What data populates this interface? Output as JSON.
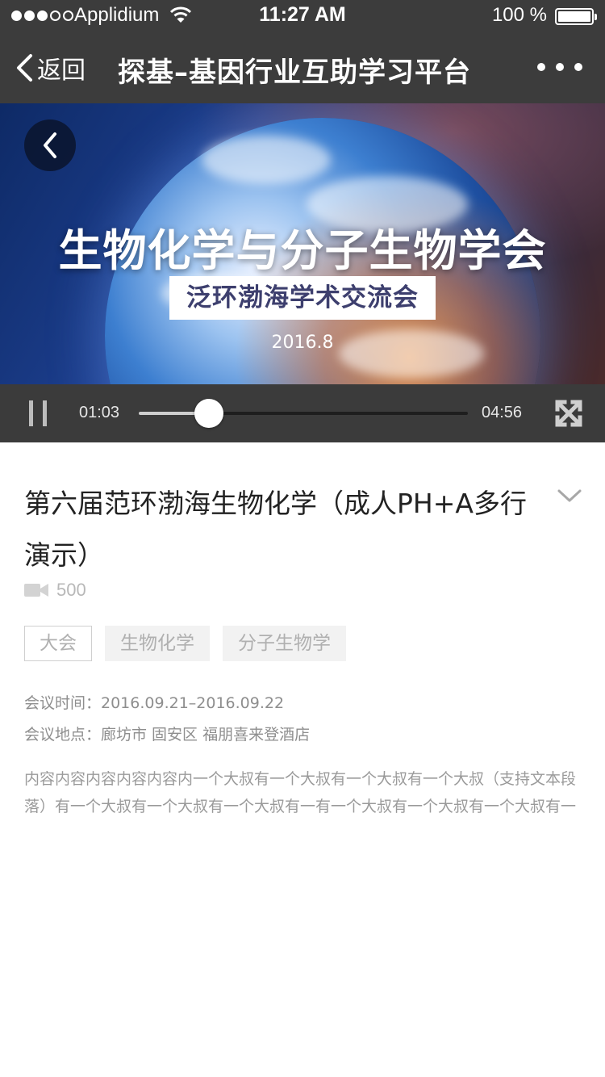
{
  "status_bar": {
    "carrier": "Applidium",
    "time": "11:27 AM",
    "battery": "100 %"
  },
  "nav": {
    "back_label": "返回",
    "title": "探基–基因行业互助学习平台"
  },
  "video": {
    "title": "生物化学与分子生物学会",
    "subtitle": "泛环渤海学术交流会",
    "date": "2016.8",
    "current_time": "01:03",
    "duration": "04:56",
    "progress": 0.213
  },
  "article": {
    "title": "第六届范环渤海生物化学（成人PH+A多行演示）",
    "views": "500",
    "tags": [
      "大会",
      "生物化学",
      "分子生物学"
    ],
    "meeting_time": "会议时间：2016.09.21–2016.09.22",
    "meeting_place": "会议地点：廊坊市 固安区 福朋喜来登酒店",
    "description": "内容内容内容内容内容内一个大叔有一个大叔有一个大叔有一个大叔（支持文本段落）有一个大叔有一个大叔有一个大叔有一有一个大叔有一个大叔有一个大叔有一"
  },
  "colors": {
    "header_bg": "#3c3c3c",
    "controls_bg": "#3b3b3b",
    "subtitle_text": "#3d3f6e"
  }
}
